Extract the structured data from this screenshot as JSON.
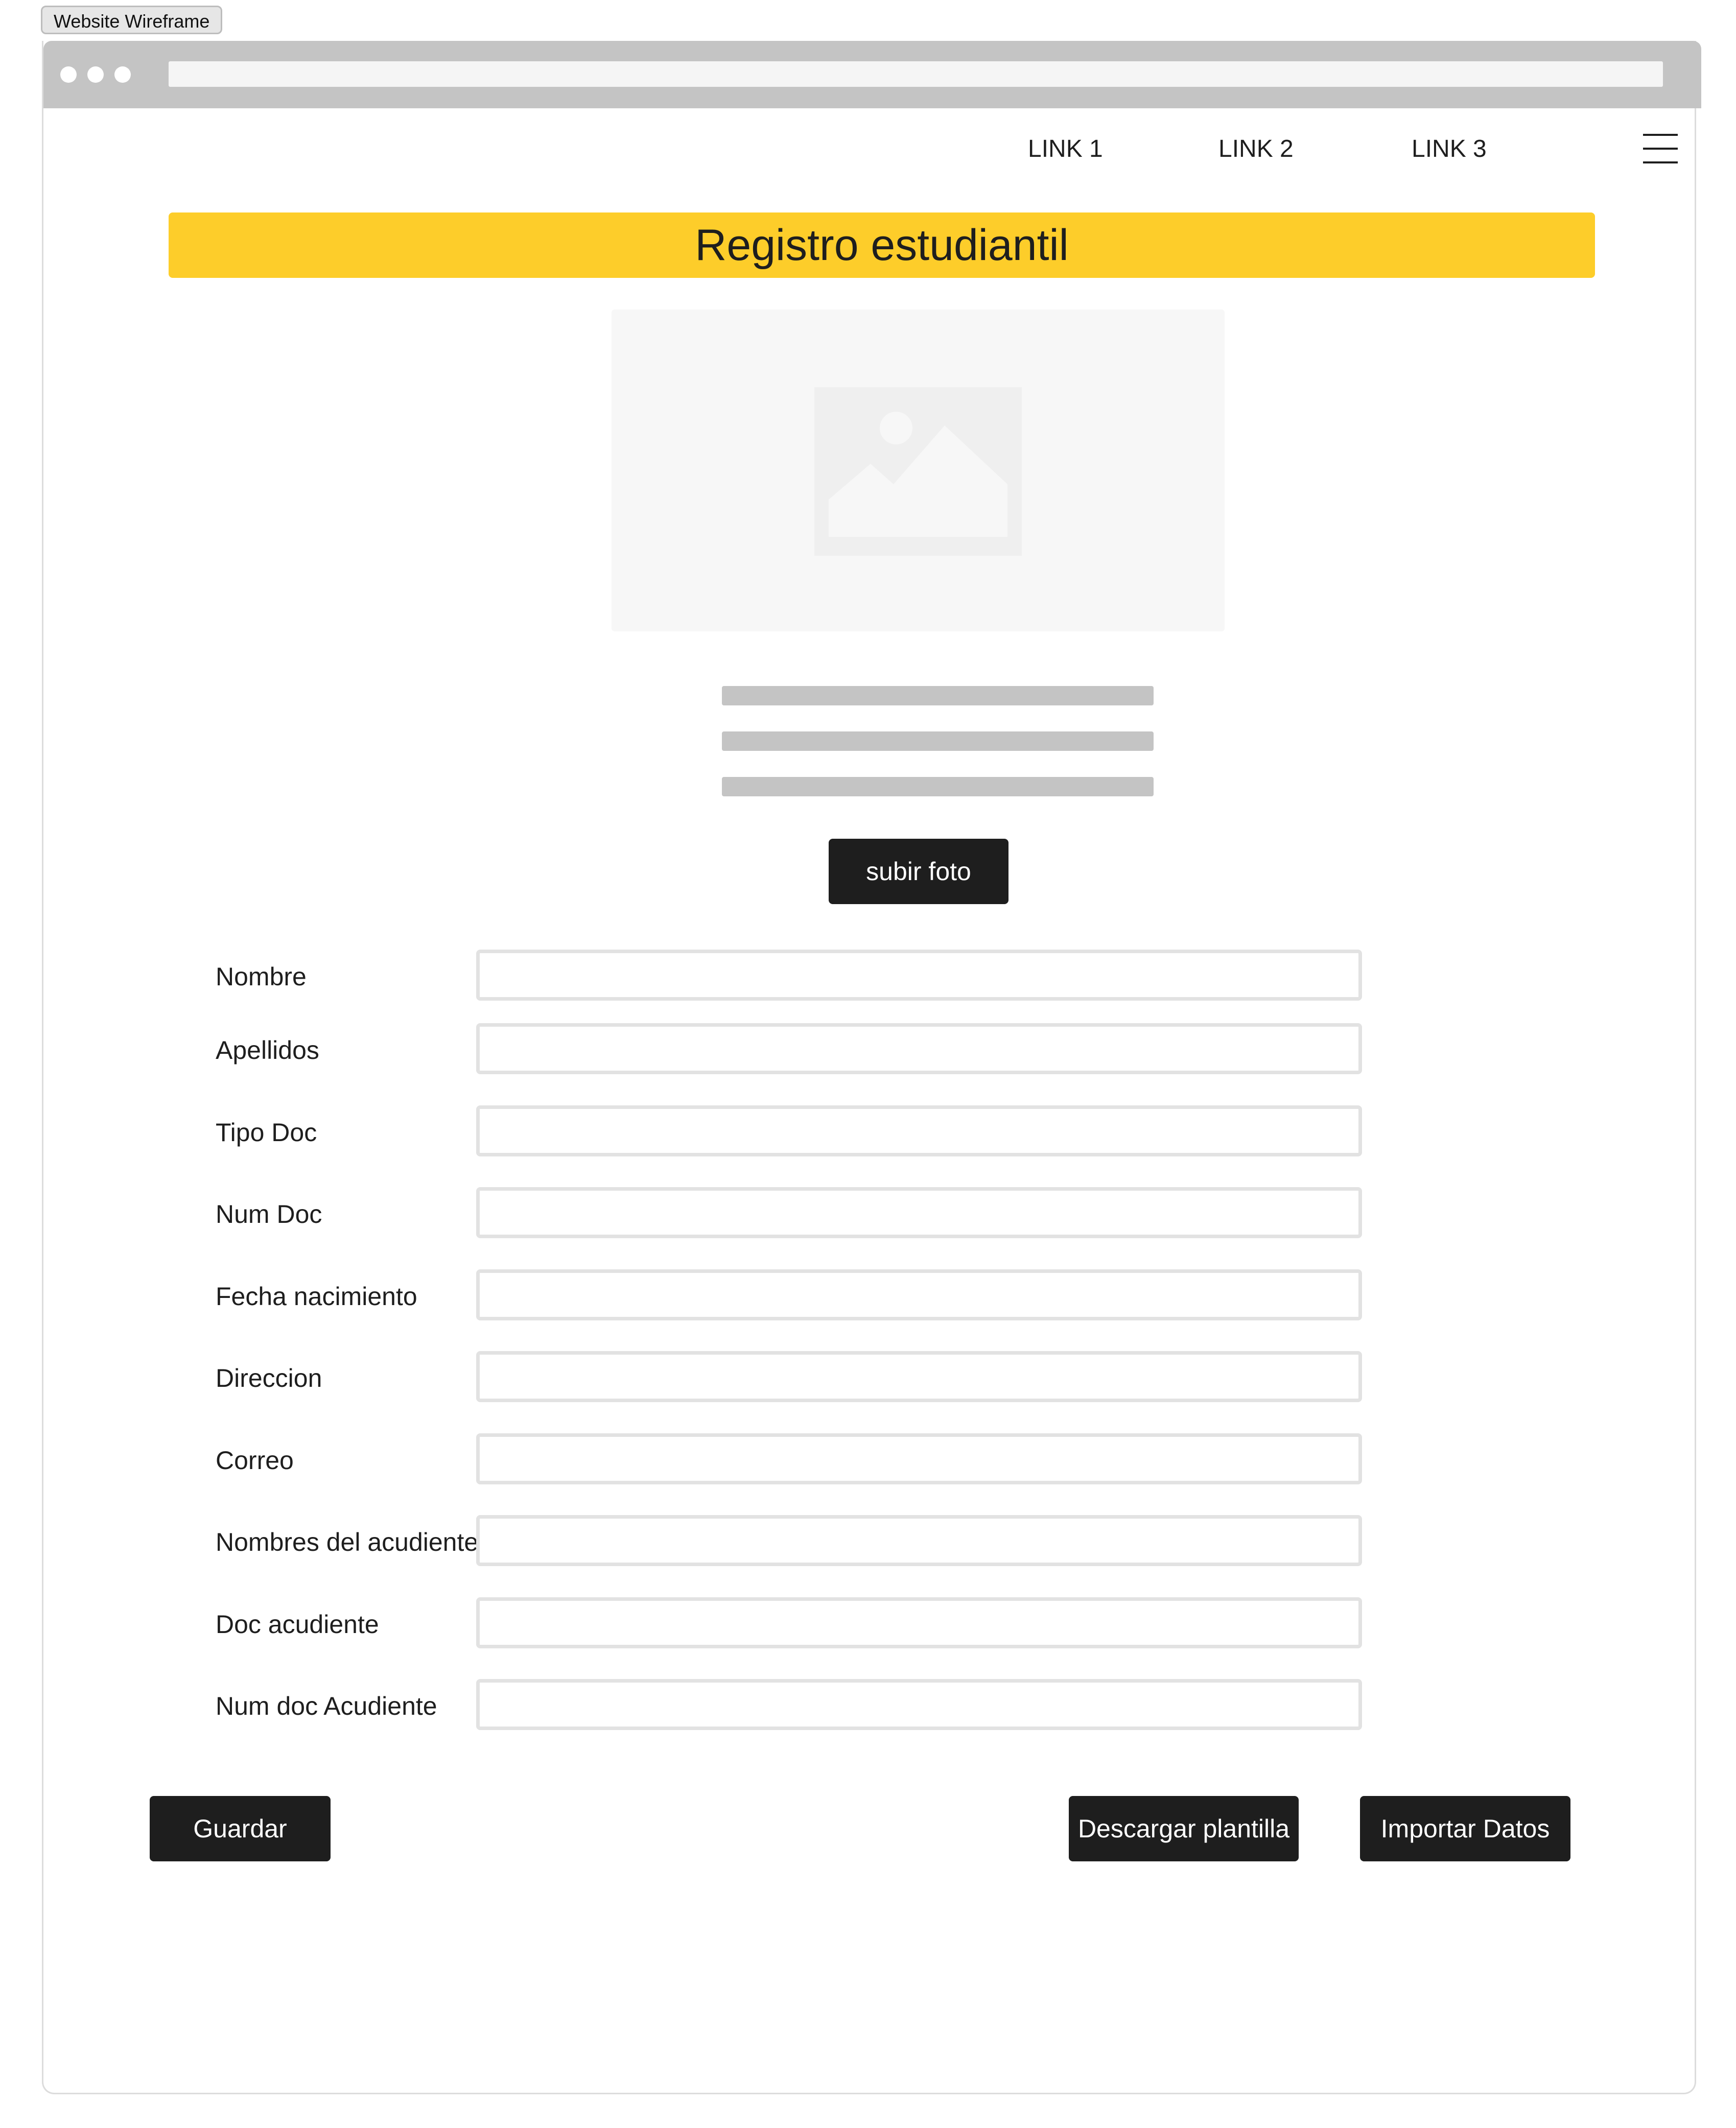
{
  "frame_label": "Website Wireframe",
  "nav": {
    "links": [
      "LINK 1",
      "LINK 2",
      "LINK 3"
    ]
  },
  "page": {
    "title": "Registro estudiantil",
    "upload_button": "subir foto"
  },
  "form": {
    "fields": [
      {
        "label": "Nombre",
        "value": ""
      },
      {
        "label": "Apellidos",
        "value": ""
      },
      {
        "label": "Tipo Doc",
        "value": ""
      },
      {
        "label": "Num Doc",
        "value": ""
      },
      {
        "label": "Fecha nacimiento",
        "value": ""
      },
      {
        "label": "Direccion",
        "value": ""
      },
      {
        "label": "Correo",
        "value": ""
      },
      {
        "label": "Nombres del acudiente",
        "value": ""
      },
      {
        "label": "Doc acudiente",
        "value": ""
      },
      {
        "label": "Num doc Acudiente",
        "value": ""
      }
    ]
  },
  "actions": {
    "save": "Guardar",
    "download_template": "Descargar plantilla",
    "import_data": "Importar Datos"
  },
  "colors": {
    "accent": "#fdcd2a",
    "button": "#1e1e1e",
    "placeholder_gray": "#c4c4c4"
  },
  "icons": {
    "image_placeholder": "image-icon",
    "menu": "hamburger-menu-icon"
  }
}
